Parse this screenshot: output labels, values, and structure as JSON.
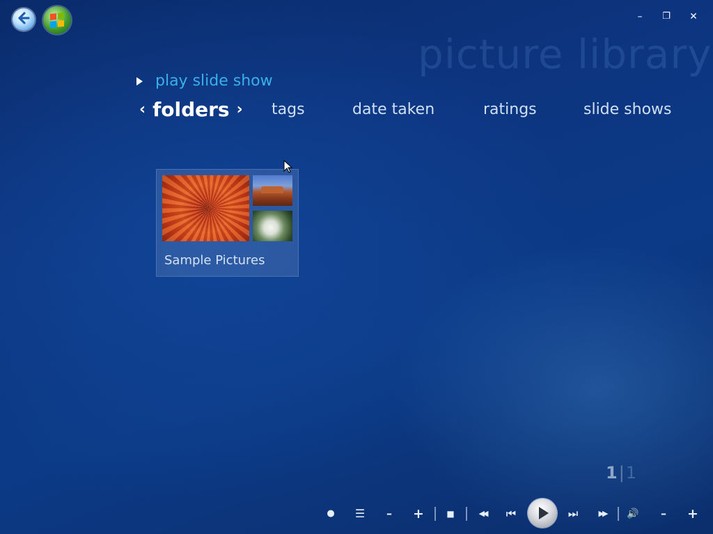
{
  "window": {
    "back_icon": "back-arrow-icon",
    "start_icon": "windows-start-orb-icon",
    "minimize_glyph": "–",
    "restore_glyph": "❐",
    "close_glyph": "✕"
  },
  "header": {
    "watermark": "picture library"
  },
  "actions": {
    "play_slide_show": "play slide show"
  },
  "nav": {
    "prev_glyph": "‹",
    "next_glyph": "›",
    "items": [
      {
        "label": "folders",
        "selected": true
      },
      {
        "label": "tags",
        "selected": false
      },
      {
        "label": "date taken",
        "selected": false
      },
      {
        "label": "ratings",
        "selected": false
      },
      {
        "label": "slide shows",
        "selected": false
      }
    ]
  },
  "content": {
    "folders": [
      {
        "name": "Sample Pictures",
        "thumbnails": [
          "flower-thumbnail",
          "desert-thumbnail",
          "rose-thumbnail"
        ]
      }
    ]
  },
  "pager": {
    "current": "1",
    "total": "1",
    "separator": "|"
  },
  "transport": {
    "record_glyph": "●",
    "guide_glyph": "☰",
    "channel_down_glyph": "–",
    "channel_up_glyph": "+",
    "stop_glyph": "■",
    "rewind_glyph": "◀◀",
    "prev_glyph": "⏮",
    "next_glyph": "⏭",
    "ffwd_glyph": "▶▶",
    "mute_glyph": "🔊",
    "vol_down_glyph": "–",
    "vol_up_glyph": "+"
  },
  "colors": {
    "accent": "#39b0e8",
    "background": "#0c3a86",
    "text": "#cfe0f5"
  }
}
